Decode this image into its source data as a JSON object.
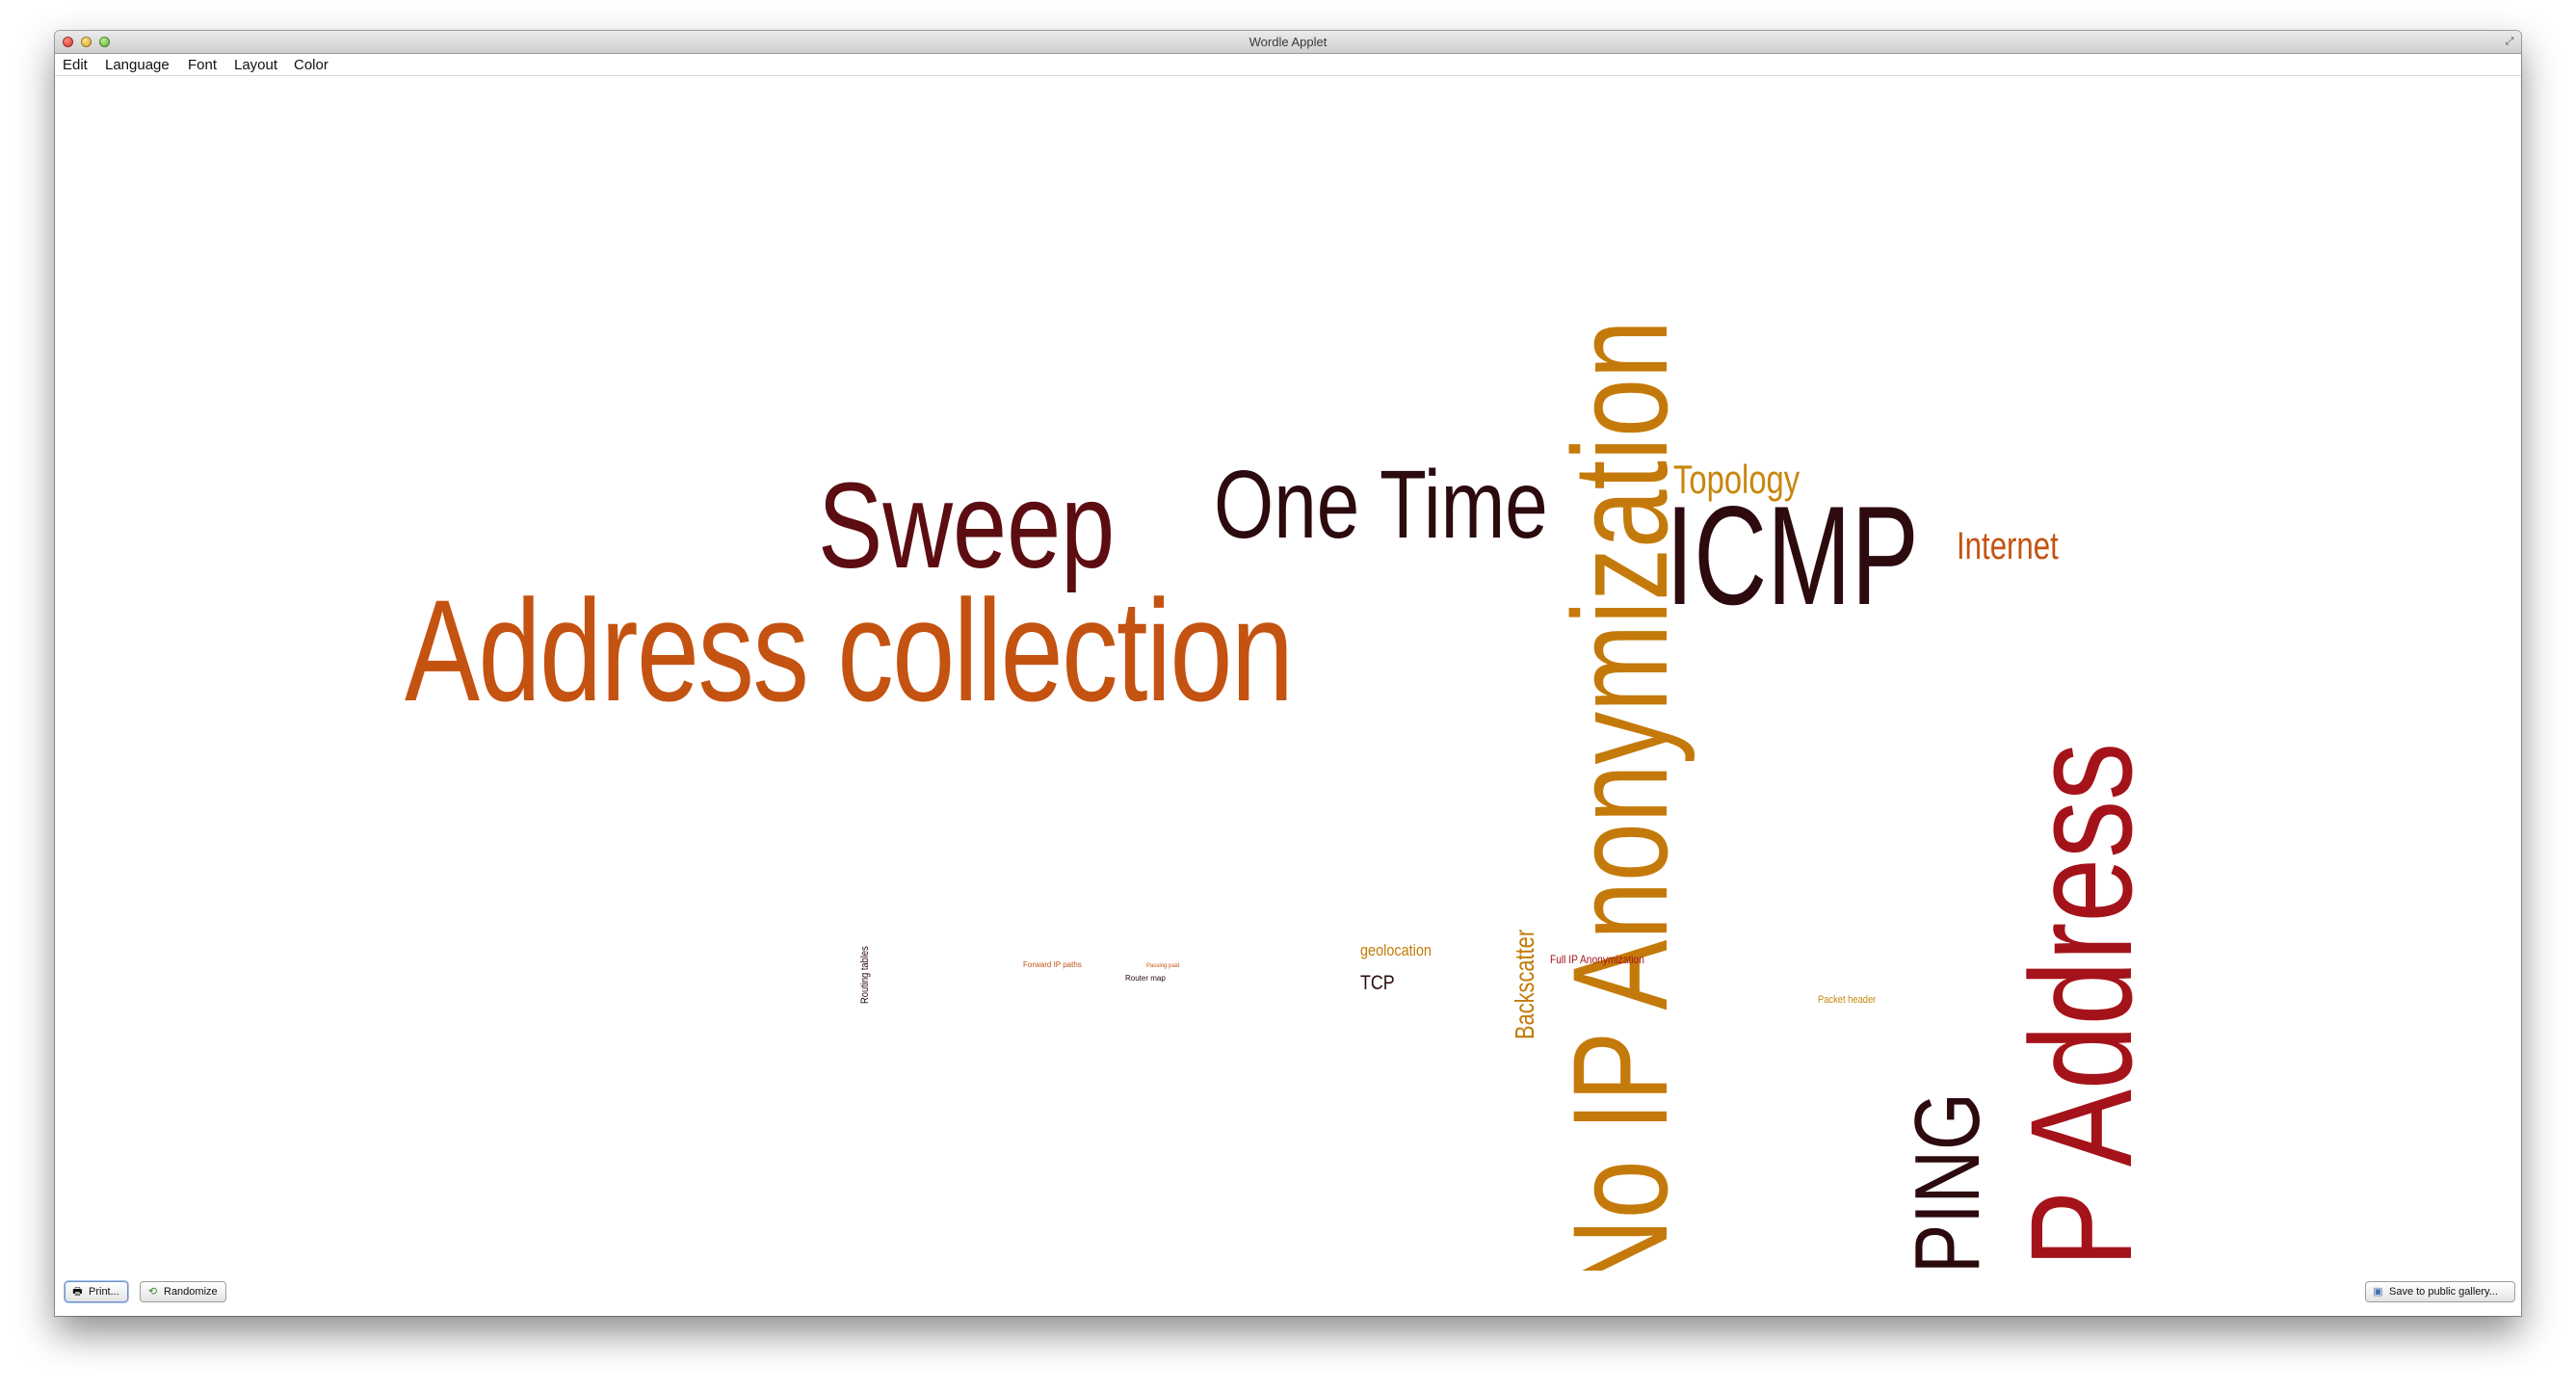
{
  "window": {
    "title": "Wordle Applet",
    "resize_icon": "⤢"
  },
  "menu": {
    "items": [
      "Edit",
      "Language",
      "Font",
      "Layout",
      "Color"
    ]
  },
  "wordcloud": {
    "colors": {
      "dark_maroon": "#3d0a0e",
      "maroon": "#5c0d12",
      "orange": "#c45210",
      "amber": "#c47a0a",
      "red": "#a5131a",
      "gold": "#c8860c"
    },
    "words": [
      "Address collection",
      "No IP Anonymization",
      "IP Address",
      "Sweep",
      "One Time",
      "ICMP",
      "PING",
      "Topology",
      "Internet",
      "Backscatter",
      "geolocation",
      "TCP",
      "Full IP Anonymization",
      "Packet header",
      "Routing tables",
      "Forward IP paths",
      "Router map",
      "Passing paid"
    ]
  },
  "bottom": {
    "print_label": "Print...",
    "print_icon": "printer-icon",
    "randomize_label": "Randomize",
    "randomize_icon": "shuffle-icon",
    "save_label": "Save to public gallery...",
    "save_icon": "save-icon"
  }
}
